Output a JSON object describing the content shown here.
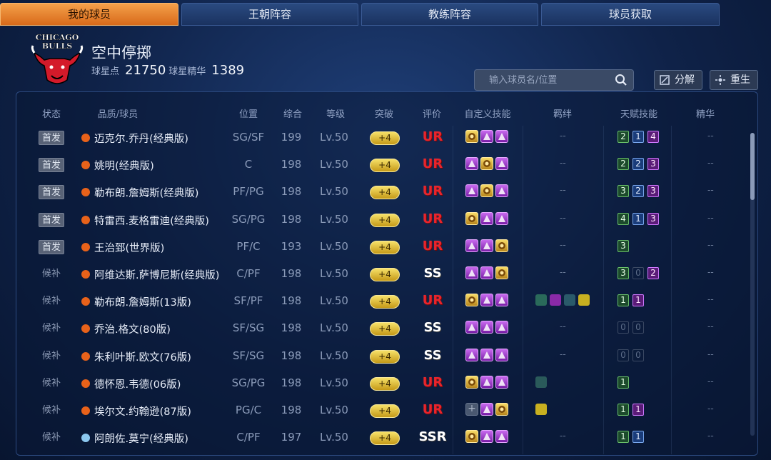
{
  "tabs": [
    {
      "label": "我的球员",
      "active": true
    },
    {
      "label": "王朝阵容",
      "active": false
    },
    {
      "label": "教练阵容",
      "active": false
    },
    {
      "label": "球员获取",
      "active": false
    }
  ],
  "team_logo_text": "CHICAGO BULLS",
  "profile": {
    "name": "空中停掷",
    "star_points_label": "球星点",
    "star_points": "21750",
    "essence_label": "球星精华",
    "essence": "1389"
  },
  "search": {
    "placeholder": "输入球员名/位置"
  },
  "buttons": {
    "decompose": "分解",
    "rebirth": "重生"
  },
  "columns": [
    "状态",
    "品质/球员",
    "位置",
    "综合",
    "等级",
    "突破",
    "评价",
    "自定义技能",
    "羁绊",
    "天赋技能",
    "精华"
  ],
  "colors": {
    "orange_quality": "#e8621a",
    "blue_quality": "#8cc8f0",
    "ur": "#e8242c",
    "accent_tab": "#f09030"
  },
  "players": [
    {
      "status": "首发",
      "starter": true,
      "quality": "orange",
      "name": "迈克尔.乔丹(经典版)",
      "pos": "SG/SF",
      "ovr": "199",
      "lvl": "Lv.50",
      "breach": "+4",
      "grade": "UR",
      "skills": [
        "gold",
        "purple",
        "purple"
      ],
      "bonds": [],
      "bond_text": "--",
      "talents": [
        [
          "2",
          "g"
        ],
        [
          "1",
          "b"
        ],
        [
          "4",
          "p"
        ]
      ],
      "essence": "--"
    },
    {
      "status": "首发",
      "starter": true,
      "quality": "orange",
      "name": "姚明(经典版)",
      "pos": "C",
      "ovr": "198",
      "lvl": "Lv.50",
      "breach": "+4",
      "grade": "UR",
      "skills": [
        "purple",
        "gold",
        "purple"
      ],
      "bonds": [],
      "bond_text": "--",
      "talents": [
        [
          "2",
          "g"
        ],
        [
          "2",
          "b"
        ],
        [
          "3",
          "p"
        ]
      ],
      "essence": "--"
    },
    {
      "status": "首发",
      "starter": true,
      "quality": "orange",
      "name": "勒布朗.詹姆斯(经典版)",
      "pos": "PF/PG",
      "ovr": "198",
      "lvl": "Lv.50",
      "breach": "+4",
      "grade": "UR",
      "skills": [
        "purple",
        "gold",
        "purple"
      ],
      "bonds": [],
      "bond_text": "--",
      "talents": [
        [
          "3",
          "g"
        ],
        [
          "2",
          "b"
        ],
        [
          "3",
          "p"
        ]
      ],
      "essence": "--"
    },
    {
      "status": "首发",
      "starter": true,
      "quality": "orange",
      "name": "特雷西.麦格雷迪(经典版)",
      "pos": "SG/PG",
      "ovr": "198",
      "lvl": "Lv.50",
      "breach": "+4",
      "grade": "UR",
      "skills": [
        "gold",
        "purple",
        "purple"
      ],
      "bonds": [],
      "bond_text": "--",
      "talents": [
        [
          "4",
          "g"
        ],
        [
          "1",
          "b"
        ],
        [
          "3",
          "p"
        ]
      ],
      "essence": "--"
    },
    {
      "status": "首发",
      "starter": true,
      "quality": "orange",
      "name": "王治郅(世界版)",
      "pos": "PF/C",
      "ovr": "193",
      "lvl": "Lv.50",
      "breach": "+4",
      "grade": "UR",
      "skills": [
        "purple",
        "purple",
        "gold"
      ],
      "bonds": [],
      "bond_text": "--",
      "talents": [
        [
          "3",
          "g"
        ]
      ],
      "essence": "--"
    },
    {
      "status": "候补",
      "starter": false,
      "quality": "orange",
      "name": "阿维达斯.萨博尼斯(经典版)",
      "pos": "C/PF",
      "ovr": "198",
      "lvl": "Lv.50",
      "breach": "+4",
      "grade": "SS",
      "skills": [
        "purple",
        "purple",
        "gold"
      ],
      "bonds": [],
      "bond_text": "--",
      "talents": [
        [
          "3",
          "g"
        ],
        [
          "0",
          "z"
        ],
        [
          "2",
          "p"
        ]
      ],
      "essence": "--"
    },
    {
      "status": "候补",
      "starter": false,
      "quality": "orange",
      "name": "勒布朗.詹姆斯(13版)",
      "pos": "SF/PF",
      "ovr": "198",
      "lvl": "Lv.50",
      "breach": "+4",
      "grade": "UR",
      "skills": [
        "gold",
        "purple",
        "purple"
      ],
      "bonds": [
        "#2a6a5a",
        "#8a2aa8",
        "#2a5a6a",
        "#c8b020"
      ],
      "bond_text": "",
      "talents": [
        [
          "1",
          "g"
        ],
        [
          "1",
          "p"
        ]
      ],
      "essence": "--"
    },
    {
      "status": "候补",
      "starter": false,
      "quality": "orange",
      "name": "乔治.格文(80版)",
      "pos": "SF/SG",
      "ovr": "198",
      "lvl": "Lv.50",
      "breach": "+4",
      "grade": "SS",
      "skills": [
        "purple",
        "purple",
        "purple"
      ],
      "bonds": [],
      "bond_text": "--",
      "talents": [
        [
          "0",
          "z"
        ],
        [
          "0",
          "z"
        ]
      ],
      "essence": "--"
    },
    {
      "status": "候补",
      "starter": false,
      "quality": "orange",
      "name": "朱利叶斯.欧文(76版)",
      "pos": "SF/SG",
      "ovr": "198",
      "lvl": "Lv.50",
      "breach": "+4",
      "grade": "SS",
      "skills": [
        "purple",
        "purple",
        "purple"
      ],
      "bonds": [],
      "bond_text": "--",
      "talents": [
        [
          "0",
          "z"
        ],
        [
          "0",
          "z"
        ]
      ],
      "essence": "--"
    },
    {
      "status": "候补",
      "starter": false,
      "quality": "orange",
      "name": "德怀恩.韦德(06版)",
      "pos": "SG/PG",
      "ovr": "198",
      "lvl": "Lv.50",
      "breach": "+4",
      "grade": "UR",
      "skills": [
        "gold",
        "purple",
        "purple"
      ],
      "bonds": [
        "#2a5a5a"
      ],
      "bond_text": "",
      "talents": [
        [
          "1",
          "g"
        ]
      ],
      "essence": "--"
    },
    {
      "status": "候补",
      "starter": false,
      "quality": "orange",
      "name": "埃尔文.约翰逊(87版)",
      "pos": "PG/C",
      "ovr": "198",
      "lvl": "Lv.50",
      "breach": "+4",
      "grade": "UR",
      "skills": [
        "empty",
        "purple",
        "gold"
      ],
      "bonds": [
        "#c8b020"
      ],
      "bond_text": "",
      "talents": [
        [
          "1",
          "g"
        ],
        [
          "1",
          "p"
        ]
      ],
      "essence": "--"
    },
    {
      "status": "候补",
      "starter": false,
      "quality": "blue",
      "name": "阿朗佐.莫宁(经典版)",
      "pos": "C/PF",
      "ovr": "197",
      "lvl": "Lv.50",
      "breach": "+4",
      "grade": "SSR",
      "skills": [
        "gold",
        "purple",
        "purple"
      ],
      "bonds": [],
      "bond_text": "--",
      "talents": [
        [
          "1",
          "g"
        ],
        [
          "1",
          "b"
        ]
      ],
      "essence": "--"
    }
  ]
}
